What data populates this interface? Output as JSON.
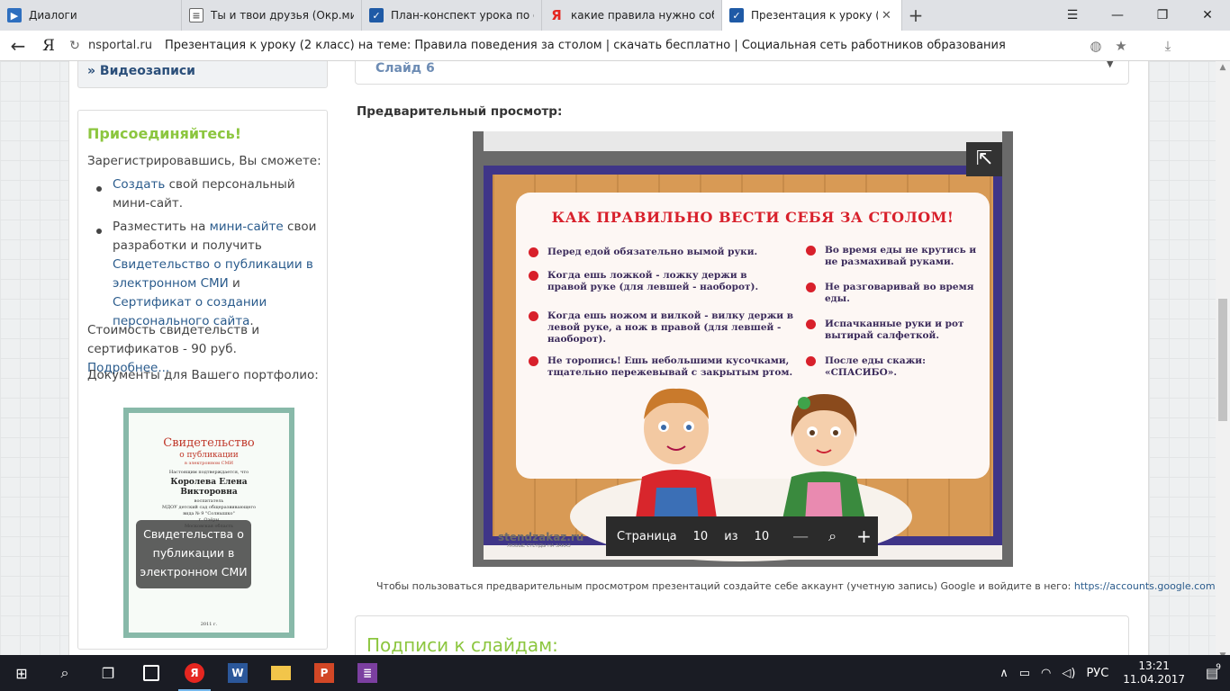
{
  "browser": {
    "tabs": [
      {
        "label": "Диалоги",
        "favicon": "video-icon"
      },
      {
        "label": "Ты и твои друзья (Окр.мир",
        "favicon": "document-icon"
      },
      {
        "label": "План-конспект урока по ок",
        "favicon": "check-icon"
      },
      {
        "label": "какие правила нужно собл",
        "favicon": "yandex-icon"
      },
      {
        "label": "Презентация к уроку (2 кл",
        "favicon": "check-icon",
        "active": true
      }
    ],
    "new_tab": "+",
    "address": {
      "domain": "nsportal.ru",
      "title": "Презентация к уроку (2 класс) на теме: Правила поведения за столом | скачать бесплатно | Социальная сеть работников образования"
    }
  },
  "sidebar": {
    "video_link": "Видеозаписи",
    "join": {
      "title": "Присоединяйтесь!",
      "intro": "Зарегистрировавшись, Вы сможете:",
      "item1_link": "Создать",
      "item1_rest": " свой персональный мини-сайт.",
      "item2_a": "Разместить на ",
      "item2_link1": "мини-сайте",
      "item2_b": " свои разработки и получить ",
      "item2_link2": "Свидетельство о публикации в электронном СМИ",
      "item2_c": "  и ",
      "item2_link3": "Сертификат о создании персонального сайта",
      "item2_d": ".",
      "cost_text": "Стоимость свидетельств и сертификатов - 90 руб. ",
      "cost_link": "Подробнее...",
      "docs_text": "Документы для Вашего портфолио:",
      "certificate": {
        "title": "Свидетельство",
        "subtitle": "о публикации",
        "sub2": "в электронном СМИ",
        "confirm": "Настоящим подтверждается, что",
        "name1": "Королева Елена",
        "name2": "Викторовна",
        "role": "воспитатель",
        "org1": "МДОУ детский сад общеразвивающего",
        "org2": "вида № 9 \"Солнышко\"",
        "city": "г. Озёры",
        "region": "Московская область",
        "year": "2011 г."
      },
      "cert_overlay": "Свидетельства о публикации в электронном СМИ"
    }
  },
  "main": {
    "slide_select": "Слайд 6",
    "preview_label": "Предварительный просмотр:",
    "slide": {
      "title": "КАК ПРАВИЛЬНО ВЕСТИ СЕБЯ ЗА СТОЛОМ!",
      "rules_left": [
        "Перед едой обязательно вымой руки.",
        "Когда ешь ложкой - ложку держи в правой руке (для левшей - наоборот).",
        "Когда ешь ножом и вилкой - вилку держи в левой руке, а нож в правой (для левшей - наоборот).",
        "Не торопись! Ешь небольшими кусочками, тщательно пережевывай с закрытым ртом."
      ],
      "rules_right": [
        "Во время еды не крутись и не размахивай руками.",
        "Не разговаривай во время еды.",
        "Испачканные руки и рот вытирай салфеткой.",
        "После еды скажи: «СПАСИБО»."
      ],
      "watermark": "stendzakaz.ru",
      "watermark_sub": "ЛЮБЫЕ СТЕНДЫ НА ЗАКАЗ"
    },
    "pager": {
      "label": "Страница",
      "current": "10",
      "of": "из",
      "total": "10"
    },
    "google_note": "Чтобы пользоваться предварительным просмотром презентаций создайте себе аккаунт (учетную запись) Google и войдите в него: ",
    "google_link": "https://accounts.google.com",
    "captions_title": "Подписи к слайдам:"
  },
  "taskbar": {
    "lang": "РУС",
    "time": "13:21",
    "date": "11.04.2017",
    "notifications": "9"
  },
  "colors": {
    "accent_green": "#8cc63f",
    "link_blue": "#2a5b8c",
    "slide_red": "#d8202b",
    "slide_frame": "#3f3588"
  }
}
